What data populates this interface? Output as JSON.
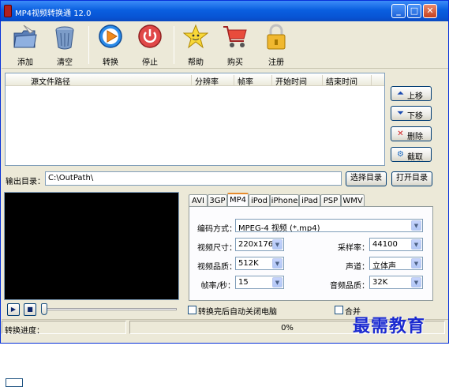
{
  "window": {
    "title": "MP4视频转换通 12.0",
    "min_glyph": "_",
    "max_glyph": "□",
    "close_glyph": "✕"
  },
  "toolbar": {
    "items": [
      {
        "label": "添加",
        "icon": "folder-add-icon"
      },
      {
        "label": "清空",
        "icon": "trash-can-icon"
      },
      {
        "label": "转换",
        "icon": "play-circle-icon"
      },
      {
        "label": "停止",
        "icon": "power-stop-icon"
      },
      {
        "label": "帮助",
        "icon": "star-help-icon"
      },
      {
        "label": "购买",
        "icon": "shopping-cart-icon"
      },
      {
        "label": "注册",
        "icon": "padlock-icon"
      }
    ]
  },
  "file_list": {
    "columns": [
      "源文件路径",
      "分辨率",
      "帧率",
      "开始时间",
      "结束时间"
    ],
    "rows": []
  },
  "side_buttons": {
    "up": "上移",
    "down": "下移",
    "delete": "删除",
    "clip": "截取"
  },
  "output": {
    "label": "输出目录：",
    "path": "C:\\OutPath\\",
    "choose_label": "选择目录",
    "open_label": "打开目录"
  },
  "format_tabs": {
    "tabs": [
      "AVI",
      "3GP",
      "MP4",
      "iPod",
      "iPhone",
      "iPad",
      "PSP",
      "WMV"
    ],
    "active": "MP4"
  },
  "settings": {
    "codec_label": "编码方式：",
    "codec_value": "MPEG-4 视频 (*.mp4)",
    "size_label": "视频尺寸：",
    "size_value": "220x176",
    "quality_label": "视频品质：",
    "quality_value": "512K",
    "fps_label": "帧率/秒：",
    "fps_value": "15",
    "samplerate_label": "采样率：",
    "samplerate_value": "44100",
    "channel_label": "声道：",
    "channel_value": "立体声",
    "audioquality_label": "音频品质：",
    "audioquality_value": "32K"
  },
  "playback": {
    "play_glyph": "▶",
    "stop_glyph": "■",
    "position_fraction": 0.0
  },
  "options": {
    "shutdown_label": "转换完后自动关闭电脑",
    "shutdown_checked": false,
    "merge_label": "合并",
    "merge_checked": false
  },
  "status": {
    "label": "转换进度：",
    "progress_text": "0%",
    "progress_fraction": 0.0
  },
  "watermark": {
    "text": "最需教育"
  },
  "colors": {
    "titlebar": "#0a5fe0",
    "accent_tab": "#e68b2c",
    "watermark": "#1a2ad0"
  }
}
